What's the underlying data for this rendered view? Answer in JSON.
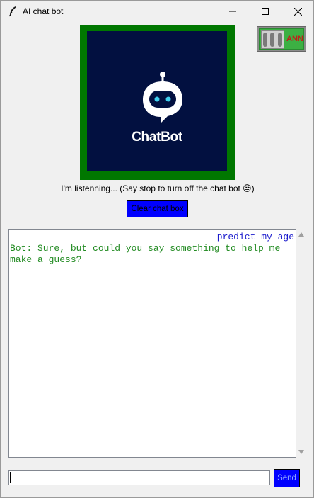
{
  "window": {
    "title": "AI chat bot"
  },
  "logo": {
    "text": "ChatBot",
    "background": "#021040",
    "frame_color": "#007700"
  },
  "ann_toggle": {
    "label": "ANN",
    "color": "#3cb043"
  },
  "status": {
    "text": "I'm listenning... (Say stop to turn off the chat bot 😒)"
  },
  "clear_button": {
    "label": "Clear chat box",
    "color": "#0000ff"
  },
  "chat": {
    "messages": [
      {
        "sender": "user",
        "text": "predict my age",
        "color": "#1a1acc"
      },
      {
        "sender": "bot",
        "text": "Bot: Sure, but could you say something to help me make a guess?",
        "color": "#228b22"
      }
    ]
  },
  "input": {
    "value": "",
    "placeholder": ""
  },
  "send_button": {
    "label": "Send",
    "color": "#0000ff"
  },
  "icons": {
    "app": "feather-icon",
    "minimize": "minimize-icon",
    "maximize": "maximize-icon",
    "close": "close-icon",
    "robot": "robot-icon"
  }
}
